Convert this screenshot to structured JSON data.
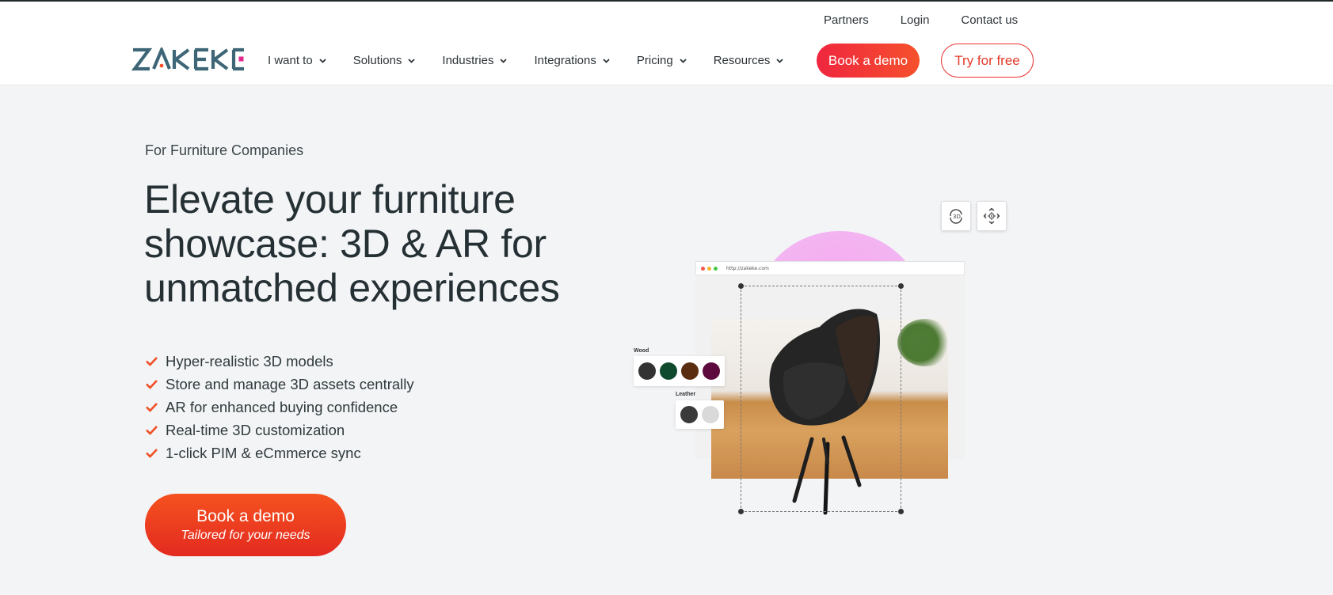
{
  "brand": {
    "logo_text": "ZAKEKE",
    "accent_color": "#f0263f",
    "orange_color": "#f5521f",
    "dark_color": "#253035"
  },
  "utility_nav": {
    "partners": "Partners",
    "login": "Login",
    "contact": "Contact us"
  },
  "nav": {
    "items": [
      {
        "label": "I want to"
      },
      {
        "label": "Solutions"
      },
      {
        "label": "Industries"
      },
      {
        "label": "Integrations"
      },
      {
        "label": "Pricing"
      },
      {
        "label": "Resources"
      }
    ],
    "book_demo": "Book a demo",
    "try_free": "Try for free"
  },
  "hero": {
    "eyebrow": "For Furniture Companies",
    "title": "Elevate your furniture showcase: 3D & AR for unmatched experiences",
    "features": [
      "Hyper-realistic 3D models",
      "Store and manage 3D assets centrally",
      "AR for enhanced buying confidence",
      "Real-time 3D customization",
      "1-click PIM & eCmmerce sync"
    ],
    "cta_main": "Book a demo",
    "cta_sub": "Tailored for your needs"
  },
  "illustration": {
    "url": "http://zakeke.com",
    "view_3d_icon": "rotate-3d-icon",
    "fullscreen_icon": "expand-arrows-icon",
    "wood_label": "Wood",
    "wood_swatches": [
      "#333333",
      "#0f4a2e",
      "#5a2d10",
      "#5c0a3e"
    ],
    "leather_label": "Leather",
    "leather_swatches": [
      "#3a3a3a",
      "#d9d9d9"
    ]
  }
}
